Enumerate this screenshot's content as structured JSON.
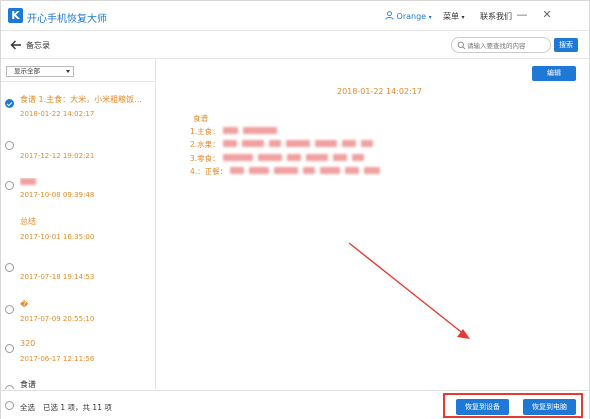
{
  "window": {
    "app_title": "开心手机恢复大师",
    "user_name": "Orange",
    "menu_label": "菜单",
    "contact_label": "联系我们",
    "minimize_glyph": "—",
    "close_glyph": "✕"
  },
  "nav": {
    "page_title": "备忘录",
    "search_placeholder": "请输入要查找的内容",
    "search_button": "搜索"
  },
  "filter": {
    "selected": "显示全部"
  },
  "notes": [
    {
      "title": "食谱 1.主食：大米，小米粗粮饭...",
      "date": "2018-01-22 14:02:17",
      "checked": true,
      "title_style": "orange"
    },
    {
      "title": "",
      "date": "2017-12-12 19:02:21",
      "checked": false,
      "title_style": "orange"
    },
    {
      "title": "",
      "date": "2017-10-08 09:39:48",
      "checked": false,
      "title_style": "orange",
      "title_blurred": true
    },
    {
      "title": "总结",
      "date": "2017-10-01 16:35:00",
      "checked": false,
      "title_style": "orange"
    },
    {
      "title": "",
      "date": "2017-07-18 19:14:53",
      "checked": false,
      "title_style": "orange"
    },
    {
      "title": "�",
      "date": "2017-07-09 20:55:10",
      "checked": false,
      "title_style": "orange"
    },
    {
      "title": "320",
      "date": "2017-06-17 12:11:56",
      "checked": false,
      "title_style": "orange"
    },
    {
      "title": "食谱",
      "date": "",
      "checked": false,
      "title_style": "dark"
    }
  ],
  "detail": {
    "edit_button": "编辑",
    "timestamp": "2018-01-22 14:02:17",
    "heading": "食谱",
    "lines": [
      {
        "prefix": "1.主食："
      },
      {
        "prefix": "2.水果："
      },
      {
        "prefix": "3.零食："
      },
      {
        "prefix": "4.：正餐："
      }
    ]
  },
  "footer": {
    "select_all": "全选",
    "selection_summary": "已选 1 项，共 11 项",
    "restore_device": "恢复到设备",
    "restore_pc": "恢复到电脑"
  },
  "colors": {
    "accent": "#1e78d6",
    "note_text": "#e38b2a",
    "annotation_red": "#e53b32"
  }
}
